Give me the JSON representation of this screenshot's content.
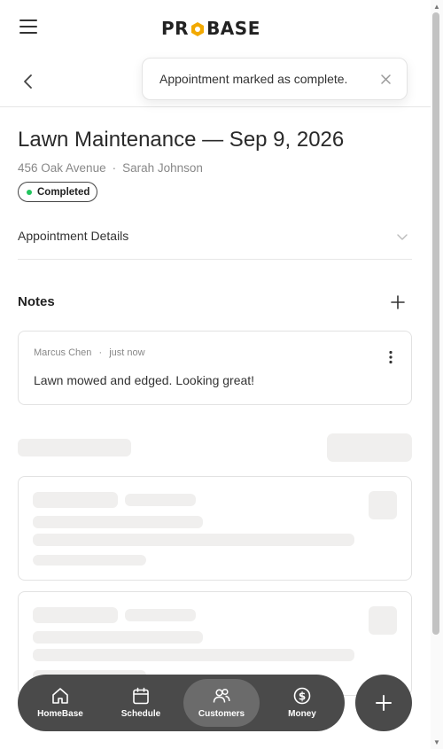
{
  "header": {
    "logo_text_left": "PR",
    "logo_text_right": "BASE",
    "menu_icon": "hamburger-menu-icon",
    "brand_accent": "#f2a900"
  },
  "toast": {
    "message": "Appointment marked as complete.",
    "close_icon": "close-icon"
  },
  "appointment": {
    "title": "Lawn Maintenance — Sep 9, 2026",
    "address": "456 Oak Avenue",
    "separator": "·",
    "customer": "Sarah Johnson",
    "status": "Completed",
    "status_color": "#22c55e"
  },
  "details": {
    "label": "Appointment Details",
    "expanded": false
  },
  "notes": {
    "heading": "Notes",
    "items": [
      {
        "author": "Marcus Chen",
        "separator": "·",
        "time": "just now",
        "body": "Lawn mowed and edged. Looking great!"
      }
    ]
  },
  "bottom_nav": {
    "items": [
      {
        "label": "HomeBase",
        "icon": "home-icon",
        "active": false
      },
      {
        "label": "Schedule",
        "icon": "calendar-icon",
        "active": false
      },
      {
        "label": "Customers",
        "icon": "customers-icon",
        "active": true
      },
      {
        "label": "Money",
        "icon": "dollar-icon",
        "active": false
      }
    ],
    "fab_icon": "plus-icon"
  }
}
